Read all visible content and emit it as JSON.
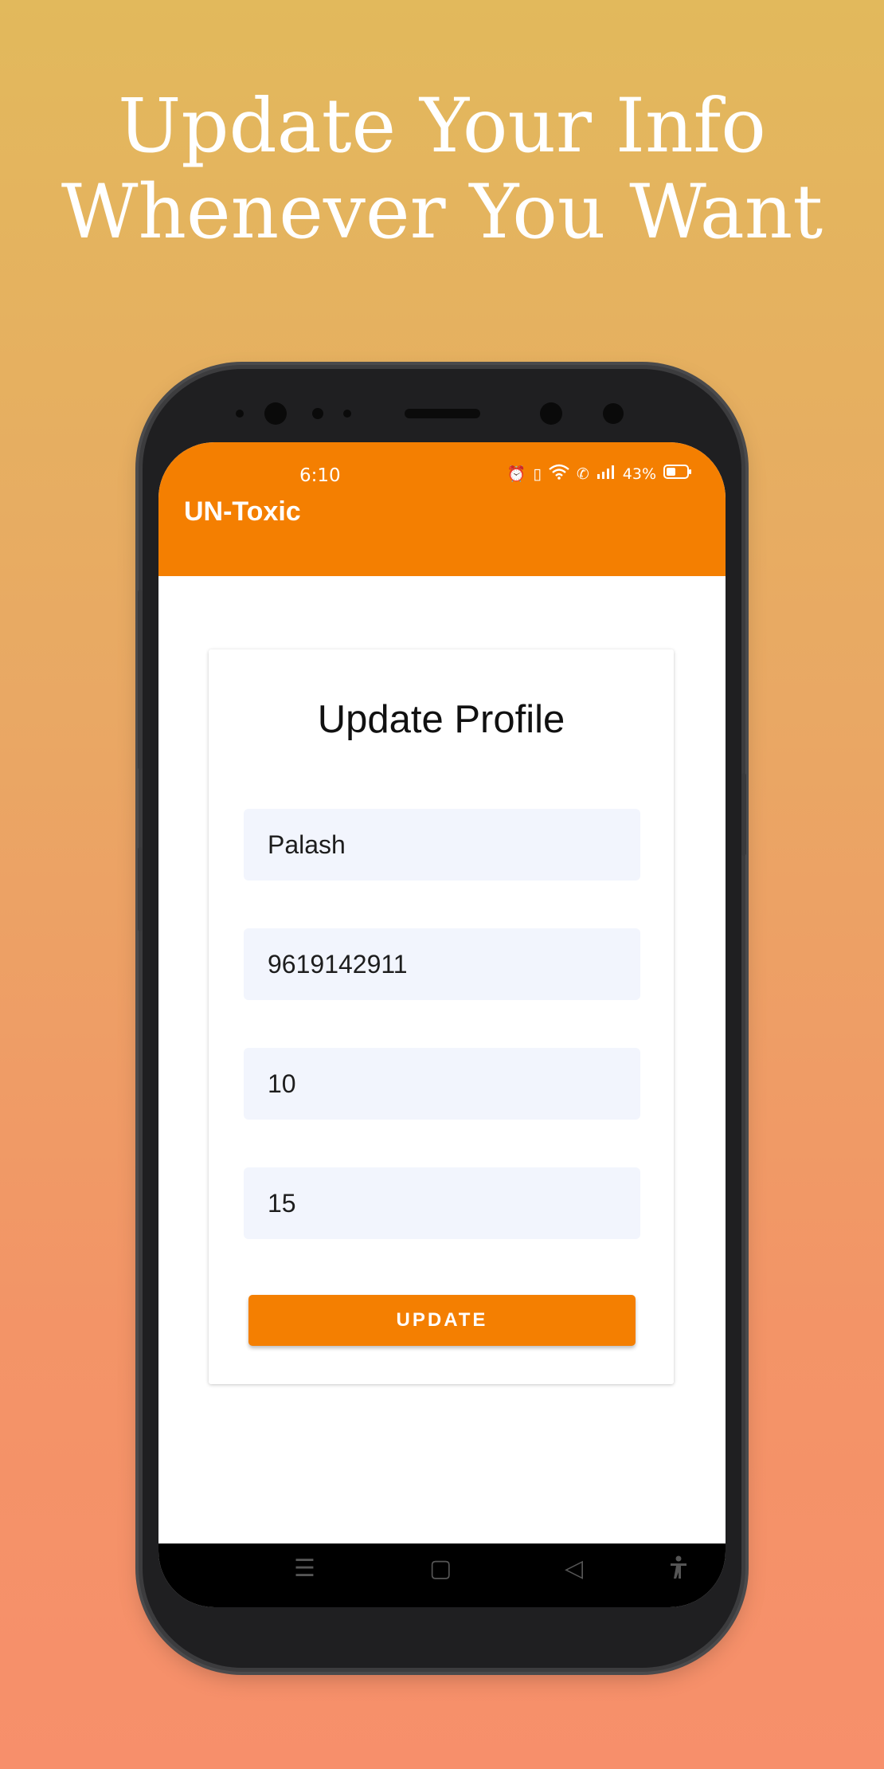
{
  "headline": {
    "line1": "Update Your Info",
    "line2": "Whenever You Want"
  },
  "status_bar": {
    "time": "6:10",
    "battery": "43%"
  },
  "app_bar": {
    "title": "UN-Toxic"
  },
  "form": {
    "title": "Update Profile",
    "fields": [
      {
        "value": "Palash"
      },
      {
        "value": "9619142911"
      },
      {
        "value": "10"
      },
      {
        "value": "15"
      }
    ],
    "button_label": "UPDATE"
  },
  "nav": {
    "menu_icon": "menu-icon",
    "home_icon": "home-icon",
    "back_icon": "back-icon",
    "accessibility_icon": "accessibility-icon"
  },
  "colors": {
    "accent": "#f47f01",
    "field_bg": "#f2f5fd"
  }
}
